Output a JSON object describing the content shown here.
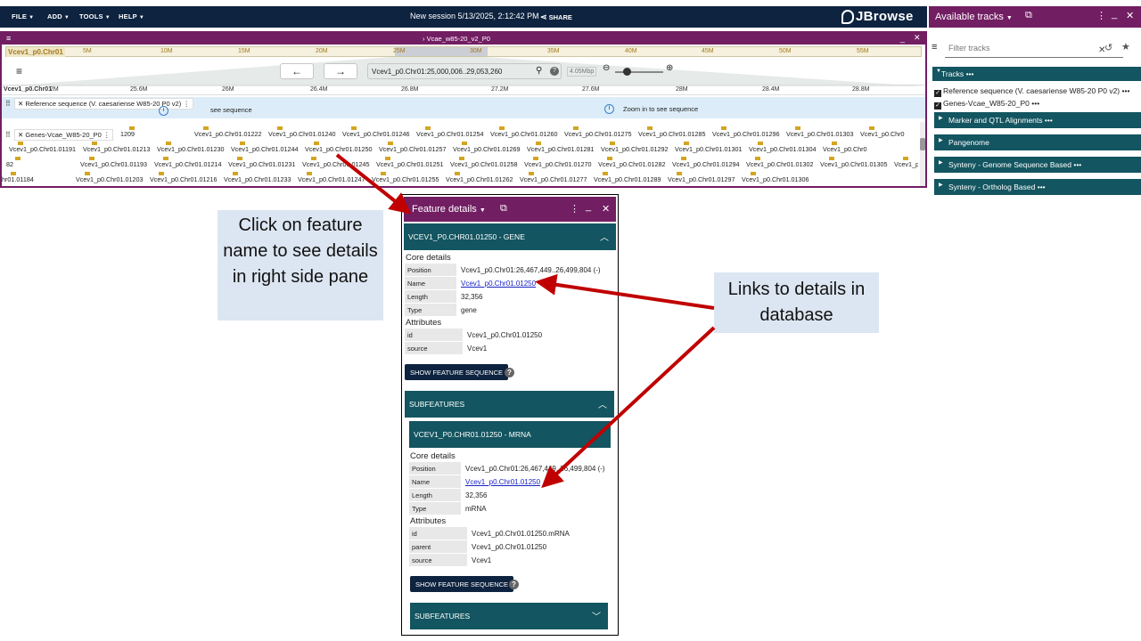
{
  "topbar": {
    "menus": [
      "FILE",
      "ADD",
      "TOOLS",
      "HELP"
    ],
    "session": "New session 5/13/2025, 2:12:42 PM",
    "share": "SHARE",
    "logo": "JBrowse"
  },
  "view": {
    "title": "Vcae_w85-20_v2_P0",
    "chrom": "Vcev1_p0.Chr01",
    "overview_ticks": [
      "5M",
      "10M",
      "15M",
      "20M",
      "25M",
      "30M",
      "35M",
      "40M",
      "45M",
      "50M",
      "55M"
    ],
    "location": "Vcev1_p0.Chr01:25,000,006..29,053,260",
    "zoom": "4.05Mbp",
    "ruler_chrom": "Vcev1_p0.Chr01",
    "ruler_ticks": [
      "2M",
      "25.6M",
      "26M",
      "26.4M",
      "26.8M",
      "27.2M",
      "27.6M",
      "28M",
      "28.4M",
      "28.8M"
    ],
    "track_ref_label": "Reference sequence (V. caesariense W85-20 P0 v2)",
    "see_sequence": "see sequence",
    "zoom_in_msg": "Zoom in to see sequence",
    "track_genes_label": "Genes-Vcae_W85-20_P0",
    "gene_rows": [
      [
        "1209",
        "Vcev1_p0.Chr01.01222",
        "Vcev1_p0.Chr01.01240",
        "Vcev1_p0.Chr01.01246",
        "Vcev1_p0.Chr01.01254",
        "Vcev1_p0.Chr01.01260",
        "Vcev1_p0.Chr01.01275",
        "Vcev1_p0.Chr01.01285",
        "Vcev1_p0.Chr01.01296",
        "Vcev1_p0.Chr01.01303",
        "Vcev1_p0.Chr0"
      ],
      [
        "Vcev1_p0.Chr01.01191",
        "Vcev1_p0.Chr01.01213",
        "Vcev1_p0.Chr01.01230",
        "Vcev1_p0.Chr01.01244",
        "Vcev1_p0.Chr01.01250",
        "Vcev1_p0.Chr01.01257",
        "Vcev1_p0.Chr01.01269",
        "Vcev1_p0.Chr01.01281",
        "Vcev1_p0.Chr01.01292",
        "Vcev1_p0.Chr01.01301",
        "Vcev1_p0.Chr01.01304",
        "Vcev1_p0.Chr0"
      ],
      [
        "82",
        "Vcev1_p0.Chr01.01193",
        "Vcev1_p0.Chr01.01214",
        "Vcev1_p0.Chr01.01231",
        "Vcev1_p0.Chr01.01245",
        "Vcev1_p0.Chr01.01251",
        "Vcev1_p0.Chr01.01258",
        "Vcev1_p0.Chr01.01270",
        "Vcev1_p0.Chr01.01282",
        "Vcev1_p0.Chr01.01294",
        "Vcev1_p0.Chr01.01302",
        "Vcev1_p0.Chr01.01305",
        "Vcev1_p"
      ],
      [
        "hr01.01184",
        "Vcev1_p0.Chr01.01203",
        "Vcev1_p0.Chr01.01216",
        "Vcev1_p0.Chr01.01233",
        "Vcev1_p0.Chr01.01247",
        "Vcev1_p0.Chr01.01255",
        "Vcev1_p0.Chr01.01262",
        "Vcev1_p0.Chr01.01277",
        "Vcev1_p0.Chr01.01289",
        "Vcev1_p0.Chr01.01297",
        "Vcev1_p0.Chr01.01306"
      ]
    ]
  },
  "tracks_panel": {
    "title": "Available tracks",
    "filter_placeholder": "Filter tracks",
    "tracks_header": "Tracks",
    "track_items": [
      "Reference sequence (V. caesariense W85-20 P0 v2)",
      "Genes-Vcae_W85-20_P0"
    ],
    "categories": [
      "Marker and QTL Alignments",
      "Pangenome",
      "Synteny - Genome Sequence Based",
      "Synteny - Ortholog Based"
    ]
  },
  "callouts": {
    "left": "Click on feature name to see details in right side pane",
    "right": "Links to details in database"
  },
  "feature_details": {
    "title": "Feature details",
    "gene_section": "VCEV1_P0.CHR01.01250 - GENE",
    "core_details": "Core details",
    "attributes": "Attributes",
    "gene_core": [
      {
        "k": "Position",
        "v": "Vcev1_p0.Chr01:26,467,449..26,499,804 (-)"
      },
      {
        "k": "Name",
        "v": "Vcev1_p0.Chr01.01250"
      },
      {
        "k": "Length",
        "v": "32,356"
      },
      {
        "k": "Type",
        "v": "gene"
      }
    ],
    "gene_attrs": [
      {
        "k": "id",
        "v": "Vcev1_p0.Chr01.01250"
      },
      {
        "k": "source",
        "v": "Vcev1"
      }
    ],
    "show_seq": "SHOW FEATURE SEQUENCE",
    "subfeatures": "SUBFEATURES",
    "mrna_section": "VCEV1_P0.CHR01.01250 - MRNA",
    "mrna_core": [
      {
        "k": "Position",
        "v": "Vcev1_p0.Chr01:26,467,449..26,499,804 (-)"
      },
      {
        "k": "Name",
        "v": "Vcev1_p0.Chr01.01250"
      },
      {
        "k": "Length",
        "v": "32,356"
      },
      {
        "k": "Type",
        "v": "mRNA"
      }
    ],
    "mrna_attrs": [
      {
        "k": "id",
        "v": "Vcev1_p0.Chr01.01250.mRNA"
      },
      {
        "k": "parent",
        "v": "Vcev1_p0.Chr01.01250"
      },
      {
        "k": "source",
        "v": "Vcev1"
      }
    ]
  },
  "colors": {
    "purple": "#721e63",
    "navy": "#0d233f",
    "teal": "#135560",
    "arrow": "#c00000",
    "callout": "#dce6f2"
  }
}
